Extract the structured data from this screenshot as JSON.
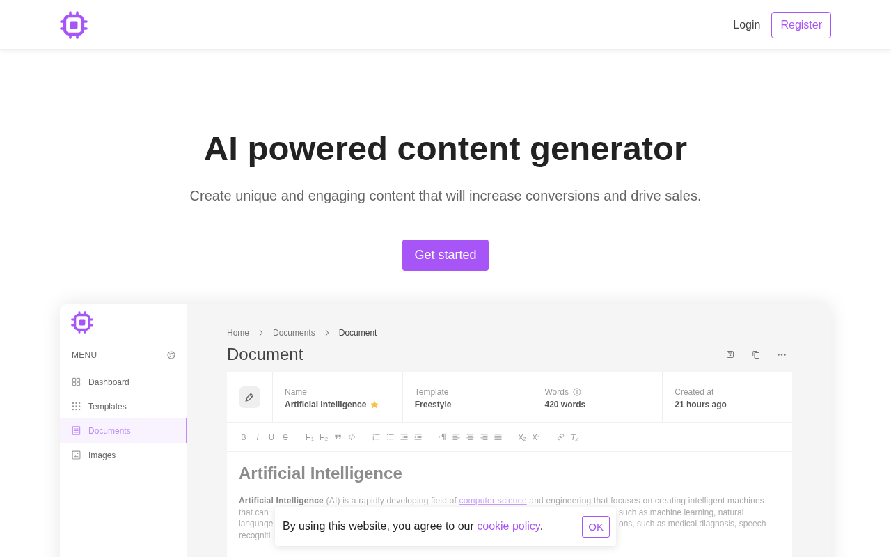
{
  "nav": {
    "login": "Login",
    "register": "Register"
  },
  "hero": {
    "title": "AI powered content generator",
    "subtitle": "Create unique and engaging content that will increase conversions and drive sales.",
    "cta": "Get started"
  },
  "app": {
    "sidebar": {
      "menu_label": "MENU",
      "items": [
        {
          "label": "Dashboard",
          "selected": false
        },
        {
          "label": "Templates",
          "selected": false
        },
        {
          "label": "Documents",
          "selected": true
        },
        {
          "label": "Images",
          "selected": false
        }
      ]
    },
    "breadcrumbs": [
      {
        "label": "Home",
        "current": false
      },
      {
        "label": "Documents",
        "current": false
      },
      {
        "label": "Document",
        "current": true
      }
    ],
    "page_title": "Document",
    "info": [
      {
        "label": "Name",
        "value": "Artificial intelligence",
        "starred": true,
        "hint": false
      },
      {
        "label": "Template",
        "value": "Freestyle",
        "starred": false,
        "hint": false
      },
      {
        "label": "Words",
        "value": "420 words",
        "starred": false,
        "hint": true
      },
      {
        "label": "Created at",
        "value": "21 hours ago",
        "starred": false,
        "hint": false
      }
    ],
    "toolbar": [
      {
        "buttons": [
          {
            "kind": "bold",
            "label": "B"
          },
          {
            "kind": "italic",
            "label": "I"
          },
          {
            "kind": "underline",
            "label": "U"
          },
          {
            "kind": "strike",
            "label": "S"
          }
        ]
      },
      {
        "buttons": [
          {
            "kind": "heading",
            "label": "H$_{1}$"
          },
          {
            "kind": "heading",
            "label": "H$_{2}$"
          },
          {
            "kind": "quote"
          },
          {
            "kind": "code"
          }
        ]
      },
      {
        "buttons": [
          {
            "kind": "ordered-list"
          },
          {
            "kind": "bullet-list"
          },
          {
            "kind": "outdent"
          },
          {
            "kind": "indent"
          }
        ]
      },
      {
        "buttons": [
          {
            "kind": "text-direction"
          },
          {
            "kind": "align-left"
          },
          {
            "kind": "align-center"
          },
          {
            "kind": "align-right"
          },
          {
            "kind": "justify"
          }
        ]
      },
      {
        "buttons": [
          {
            "kind": "subscript",
            "label": "X$_{2}$"
          },
          {
            "kind": "superscript",
            "label": "X$^{2}$"
          }
        ]
      },
      {
        "buttons": [
          {
            "kind": "link"
          },
          {
            "kind": "clear-format",
            "label": "T$_{x}$"
          }
        ]
      }
    ],
    "document": {
      "heading": "Artificial Intelligence",
      "first_line": {
        "before": "**Artificial Intelligence** (AI) is a rapidly developing field of ",
        "link": "computer science",
        "after": " and engineering that focuses on creating intelligent machines"
      },
      "covered_lines": [
        {
          "left": "that can",
          "right": "such as machine learning, natural"
        },
        {
          "left": "language",
          "right": "ons, such as medical diagnosis, speech"
        },
        {
          "left": "recogniti"
        }
      ]
    }
  },
  "cookie_banner": {
    "before": "By using this website, you agree to our ",
    "link": "cookie policy",
    "after": ".",
    "button": "OK"
  }
}
